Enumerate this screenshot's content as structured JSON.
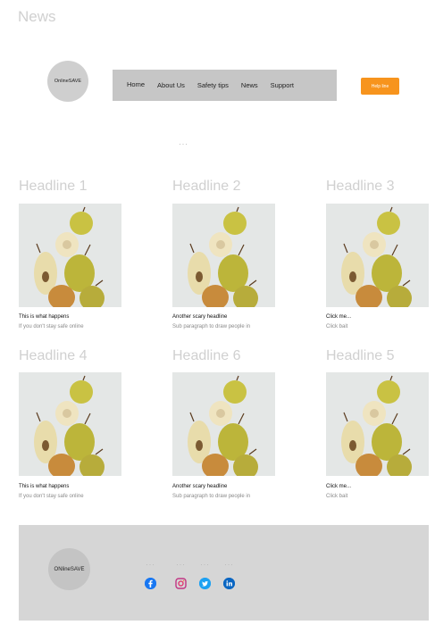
{
  "page": {
    "title": "News"
  },
  "header": {
    "logo_text": "OnlineSAVE",
    "nav": [
      {
        "label": "Home"
      },
      {
        "label": "About Us"
      },
      {
        "label": "Safety tips"
      },
      {
        "label": "News"
      },
      {
        "label": "Support"
      }
    ],
    "help_button": "Help line"
  },
  "placeholders": {
    "dots": "···"
  },
  "cards": [
    {
      "headline": "Headline 1",
      "title": "This is what happens",
      "sub": "If you don't stay safe online"
    },
    {
      "headline": "Headline 2",
      "title": "Another scary headline",
      "sub": "Sub paragraph to draw people in"
    },
    {
      "headline": "Headline 3",
      "title": "Click me...",
      "sub": "Click bait"
    },
    {
      "headline": "Headline 4",
      "title": "This is what happens",
      "sub": "If you don't stay safe online"
    },
    {
      "headline": "Headline 6",
      "title": "Another scary headline",
      "sub": "Sub paragraph to draw people in"
    },
    {
      "headline": "Headline 5",
      "title": "Click me...",
      "sub": "Click bait"
    }
  ],
  "footer": {
    "logo_text": "ONlineSAVE",
    "social": [
      {
        "icon": "facebook-icon",
        "color": "#1877f2"
      },
      {
        "icon": "instagram-icon",
        "color": "#c13584"
      },
      {
        "icon": "twitter-icon",
        "color": "#1da1f2"
      },
      {
        "icon": "linkedin-icon",
        "color": "#0a66c2"
      }
    ]
  }
}
